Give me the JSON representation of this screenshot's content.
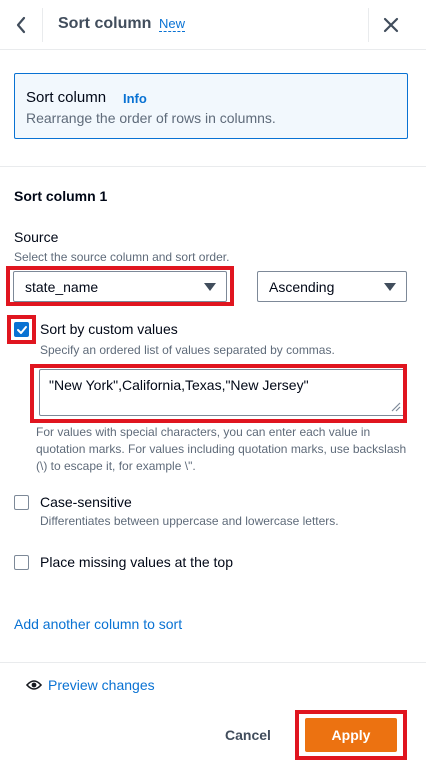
{
  "header": {
    "title": "Sort column",
    "new_label": "New"
  },
  "info": {
    "title": "Sort column",
    "link": "Info",
    "description": "Rearrange the order of rows in columns."
  },
  "section": {
    "title": "Sort column 1",
    "source_label": "Source",
    "source_description": "Select the source column and sort order.",
    "source_value": "state_name",
    "order_value": "Ascending"
  },
  "custom_values": {
    "label": "Sort by custom values",
    "description": "Specify an ordered list of values separated by commas.",
    "checked": true,
    "value": "\"New York\",California,Texas,\"New Jersey\"",
    "hint": "For values with special characters, you can enter each value in quotation marks. For values including quotation marks, use backslash (\\) to escape it, for example \\\"."
  },
  "case_sensitive": {
    "label": "Case-sensitive",
    "description": "Differentiates between uppercase and lowercase letters.",
    "checked": false
  },
  "missing_top": {
    "label": "Place missing values at the top",
    "checked": false
  },
  "add_column_link": "Add another column to sort",
  "footer": {
    "preview_label": "Preview changes",
    "cancel_label": "Cancel",
    "apply_label": "Apply"
  },
  "colors": {
    "accent": "#0972d3",
    "apply": "#ec7211",
    "highlight": "#e0151f"
  },
  "icons": [
    "chevron-left-icon",
    "close-icon",
    "caret-down-icon",
    "checkmark-icon",
    "resize-grip-icon",
    "eye-icon"
  ]
}
